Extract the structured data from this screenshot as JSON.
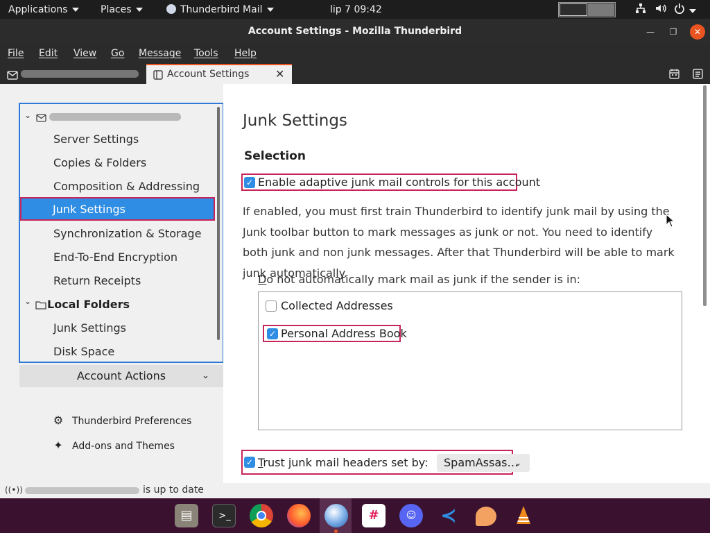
{
  "topbar": {
    "applications": "Applications",
    "places": "Places",
    "app_name": "Thunderbird Mail",
    "clock": "lip 7  09:42"
  },
  "window": {
    "title": "Account Settings - Mozilla Thunderbird"
  },
  "menu": {
    "file": "File",
    "edit": "Edit",
    "view": "View",
    "go": "Go",
    "message": "Message",
    "tools": "Tools",
    "help": "Help"
  },
  "tabs": {
    "settings_label": "Account Settings",
    "close": "✕"
  },
  "sidebar": {
    "items": [
      "Server Settings",
      "Copies & Folders",
      "Composition & Addressing",
      "Junk Settings",
      "Synchronization & Storage",
      "End-To-End Encryption",
      "Return Receipts"
    ],
    "local_folders": "Local Folders",
    "local_items": [
      "Junk Settings",
      "Disk Space"
    ],
    "account_actions": "Account Actions",
    "preferences": "Thunderbird Preferences",
    "addons": "Add-ons and Themes"
  },
  "main": {
    "title": "Junk Settings",
    "section": "Selection",
    "enable_label": "Enable adaptive junk mail controls for this account",
    "enable_checked": true,
    "explanation": "If enabled, you must first train Thunderbird to identify junk mail by using the Junk toolbar button to mark messages as junk or not. You need to identify both junk and non junk messages. After that Thunderbird will be able to mark junk automatically.",
    "not_junk_prefix": "D",
    "not_junk_rest": "o not automatically mark mail as junk if the sender is in:",
    "address_books": [
      {
        "label": "Collected Addresses",
        "checked": false
      },
      {
        "label": "Personal Address Book",
        "checked": true
      }
    ],
    "trust_prefix": "T",
    "trust_rest": "rust junk mail headers set by:",
    "trust_checked": true,
    "trust_value": "SpamAssas…"
  },
  "status": {
    "text": "is up to date"
  },
  "colors": {
    "accent": "#e95420",
    "selection": "#2f8ee3",
    "highlight_border": "#c7245a"
  }
}
